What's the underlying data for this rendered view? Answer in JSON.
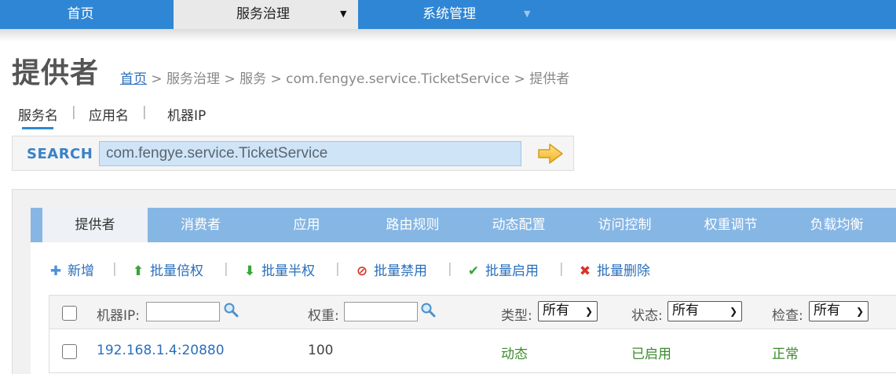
{
  "topnav": {
    "items": [
      {
        "label": "首页"
      },
      {
        "label": "服务治理"
      },
      {
        "label": "系统管理"
      }
    ],
    "dropdown_arrow": "▼"
  },
  "page": {
    "title": "提供者",
    "breadcrumb": {
      "home": "首页",
      "rest": " > 服务治理 > 服务 > com.fengye.service.TicketService > 提供者"
    }
  },
  "search": {
    "tabs": [
      {
        "label": "服务名"
      },
      {
        "label": "应用名"
      },
      {
        "label": "机器IP"
      }
    ],
    "separator": "|",
    "label": "SEARCH",
    "value": "com.fengye.service.TicketService",
    "go_icon": "arrow-right-icon"
  },
  "tabs": [
    {
      "label": "提供者"
    },
    {
      "label": "消费者"
    },
    {
      "label": "应用"
    },
    {
      "label": "路由规则"
    },
    {
      "label": "动态配置"
    },
    {
      "label": "访问控制"
    },
    {
      "label": "权重调节"
    },
    {
      "label": "负载均衡"
    }
  ],
  "toolbar": {
    "separator": "|",
    "actions": [
      {
        "label": "新增",
        "icon": "plus-icon",
        "glyph": "✚",
        "color": "#4a90d9"
      },
      {
        "label": "批量倍权",
        "icon": "arrow-up-icon",
        "glyph": "⬆",
        "color": "#3aa53a"
      },
      {
        "label": "批量半权",
        "icon": "arrow-down-icon",
        "glyph": "⬇",
        "color": "#3aa53a"
      },
      {
        "label": "批量禁用",
        "icon": "forbid-icon",
        "glyph": "⊘",
        "color": "#d9342b"
      },
      {
        "label": "批量启用",
        "icon": "check-icon",
        "glyph": "✔",
        "color": "#3aa53a"
      },
      {
        "label": "批量删除",
        "icon": "delete-icon",
        "glyph": "✖",
        "color": "#d9342b"
      }
    ]
  },
  "table": {
    "filters": {
      "ip_label": "机器IP:",
      "weight_label": "权重:",
      "type_label": "类型:",
      "type_value": "所有",
      "status_label": "状态:",
      "status_value": "所有",
      "check_label": "检查:",
      "check_value": "所有"
    },
    "rows": [
      {
        "address": "192.168.1.4:20880",
        "weight": "100",
        "type": "动态",
        "status": "已启用",
        "check": "正常"
      }
    ]
  },
  "colors": {
    "nav_blue": "#2f86d4",
    "tab_blue": "#86b6e4",
    "link_blue": "#2a6fbc",
    "ok_green": "#3d8a2e"
  }
}
